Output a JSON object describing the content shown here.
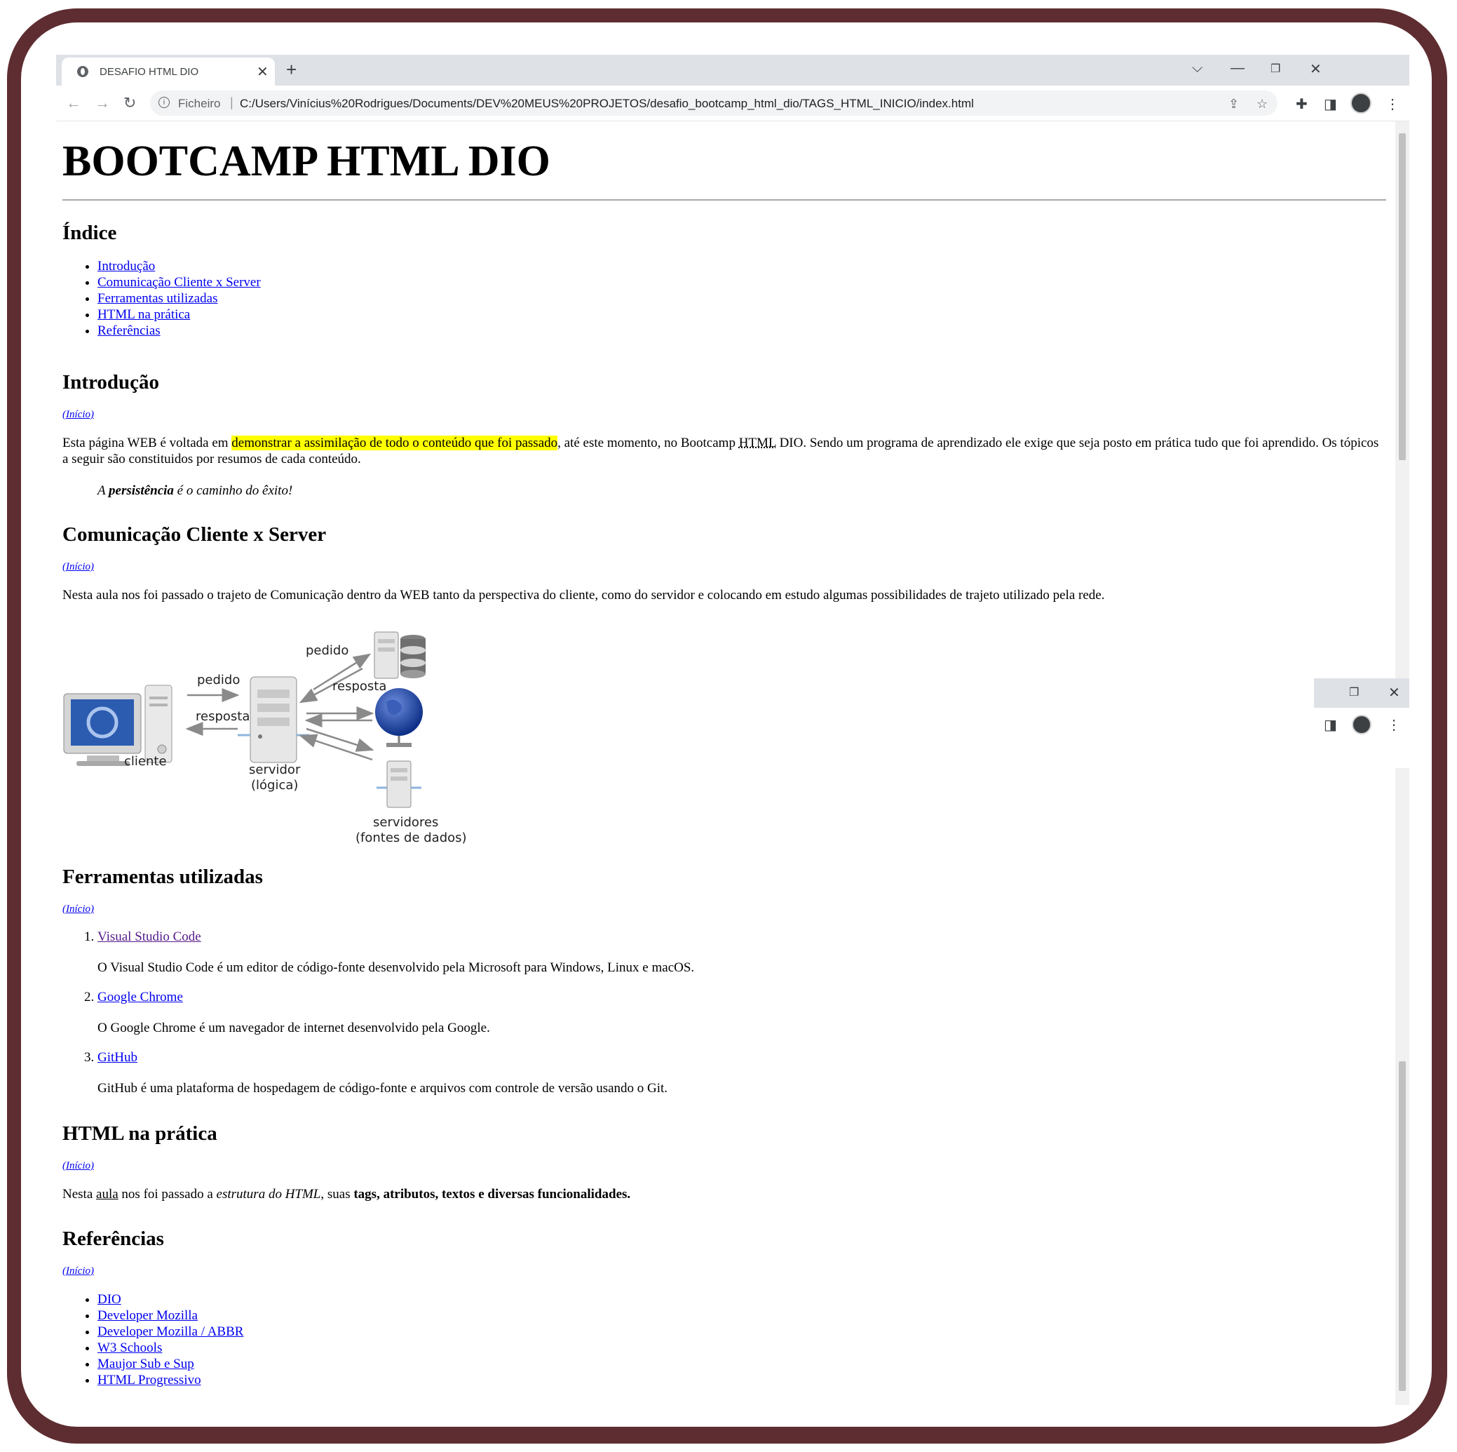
{
  "browser": {
    "tab_title": "DESAFIO HTML DIO",
    "scheme_label": "Ficheiro",
    "url": "C:/Users/Vinícius%20Rodrigues/Documents/DEV%20MEUS%20PROJETOS/desafio_bootcamp_html_dio/TAGS_HTML_INICIO/index.html",
    "icons": [
      "globe-icon",
      "close-icon",
      "plus-icon",
      "chevron-down-icon",
      "minimize-icon",
      "restore-icon",
      "back-icon",
      "forward-icon",
      "reload-icon",
      "info-icon",
      "share-icon",
      "star-icon",
      "extensions-icon",
      "side-panel-icon",
      "avatar",
      "more-icon"
    ]
  },
  "page": {
    "title": "BOOTCAMP HTML DIO",
    "index_heading": "Índice",
    "index_items": [
      "Introdução",
      "Comunicação Cliente x Server",
      "Ferramentas utilizadas",
      "HTML na prática",
      "Referências"
    ],
    "inicio_link": "(Início)",
    "intro": {
      "heading": "Introdução",
      "p_before": "Esta página WEB é voltada em ",
      "p_mark": "demonstrar a assimilação de todo o conteúdo que foi passado",
      "p_mid": ", até este momento, no Bootcamp ",
      "p_abbr": "HTML",
      "p_after": " DIO. Sendo um programa de aprendizado ele exige que seja posto em prática tudo que foi aprendido. Os tópicos a seguir são constituidos por resumos de cada conteúdo.",
      "quote_a": "A ",
      "quote_b": "persistência",
      "quote_c": " é o caminho do êxito!"
    },
    "comm": {
      "heading": "Comunicação Cliente x Server",
      "text": "Nesta aula nos foi passado o trajeto de Comunicação dentro da WEB tanto da perspectiva do cliente, como do servidor e colocando em estudo algumas possibilidades de trajeto utilizado pela rede.",
      "diagram": {
        "pedido": "pedido",
        "resposta": "resposta",
        "cliente": "cliente",
        "servidor": "servidor",
        "logica": "(lógica)",
        "servidores": "servidores",
        "fontes": "(fontes de dados)"
      }
    },
    "tools": {
      "heading": "Ferramentas utilizadas",
      "items": [
        {
          "num": "1.",
          "name": "Visual Studio Code",
          "desc": "O Visual Studio Code é um editor de código-fonte desenvolvido pela Microsoft para Windows, Linux e macOS."
        },
        {
          "num": "2.",
          "name": "Google Chrome",
          "desc": "O Google Chrome é um navegador de internet desenvolvido pela Google."
        },
        {
          "num": "3.",
          "name": "GitHub",
          "desc": "GitHub é uma plataforma de hospedagem de código-fonte e arquivos com controle de versão usando o Git."
        }
      ]
    },
    "practice": {
      "heading": "HTML na prática",
      "t1": "Nesta ",
      "t2": "aula",
      "t3": " nos foi passado a ",
      "t4": "estrutura do HTML",
      "t5": ", suas ",
      "t6": "tags, atributos, textos e diversas funcionalidades."
    },
    "refs": {
      "heading": "Referências",
      "items": [
        "DIO",
        "Developer Mozilla",
        "Developer Mozilla / ABBR",
        "W3 Schools",
        "Maujor Sub e Sup",
        "HTML Progressivo"
      ]
    }
  }
}
